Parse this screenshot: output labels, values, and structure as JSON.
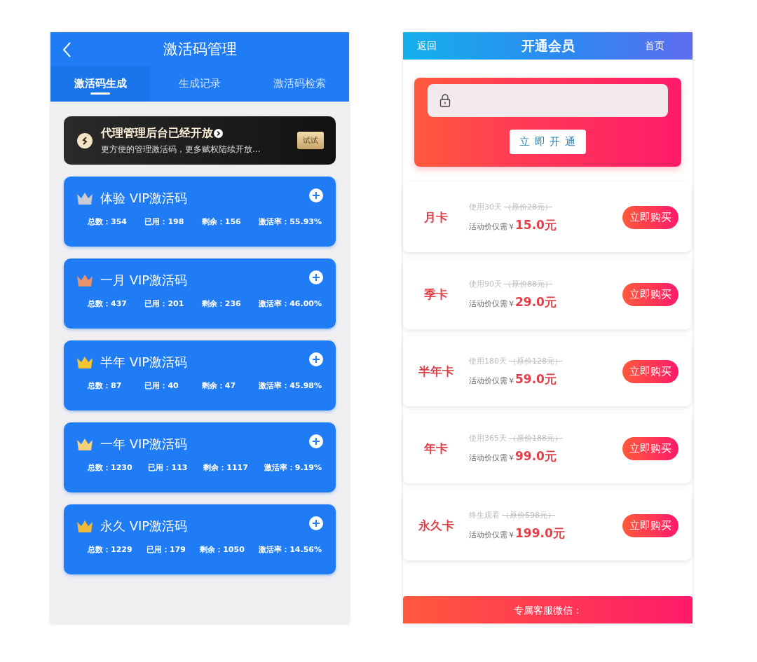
{
  "left": {
    "title": "激活码管理",
    "tabs": [
      {
        "label": "激活码生成",
        "selected": true
      },
      {
        "label": "生成记录",
        "selected": false
      },
      {
        "label": "激活码检索",
        "selected": false
      }
    ],
    "banner": {
      "title": "代理管理后台已经开放",
      "subtitle": "更方便的管理激活码，更多赋权陆续开放...",
      "button": "试试"
    },
    "cards": [
      {
        "title": "体验 VIP激活码",
        "color": "#c9ccd4",
        "stats": [
          "总数：354",
          "已用：198",
          "剩余：156",
          "激活率：55.93%"
        ]
      },
      {
        "title": "一月 VIP激活码",
        "color": "#e8936a",
        "stats": [
          "总数：437",
          "已用：201",
          "剩余：236",
          "激活率：46.00%"
        ]
      },
      {
        "title": "半年 VIP激活码",
        "color": "#f5c431",
        "stats": [
          "总数：87",
          "已用：40",
          "剩余：47",
          "激活率：45.98%"
        ]
      },
      {
        "title": "一年 VIP激活码",
        "color": "#f3d27a",
        "stats": [
          "总数：1230",
          "已用：113",
          "剩余：1117",
          "激活率：9.19%"
        ]
      },
      {
        "title": "永久 VIP激活码",
        "color": "#f0b93a",
        "stats": [
          "总数：1229",
          "已用：179",
          "剩余：1050",
          "激活率：14.56%"
        ]
      }
    ]
  },
  "right": {
    "back": "返回",
    "title": "开通会员",
    "home": "首页",
    "activate_button": "立 即 开 通",
    "plans": [
      {
        "name": "月卡",
        "duration": "使用30天",
        "original_price": "（原价28元）",
        "price_label": "活动价仅需￥",
        "price": "15.0元",
        "button": "立即购买"
      },
      {
        "name": "季卡",
        "duration": "使用90天",
        "original_price": "（原价88元）",
        "price_label": "活动价仅需￥",
        "price": "29.0元",
        "button": "立即购买"
      },
      {
        "name": "半年卡",
        "duration": "使用180天",
        "original_price": "（原价128元）",
        "price_label": "活动价仅需￥",
        "price": "59.0元",
        "button": "立即购买"
      },
      {
        "name": "年卡",
        "duration": "使用365天",
        "original_price": "（原价188元）",
        "price_label": "活动价仅需￥",
        "price": "99.0元",
        "button": "立即购买"
      },
      {
        "name": "永久卡",
        "duration": "终生观看",
        "original_price": "（原价598元）",
        "price_label": "活动价仅需￥",
        "price": "199.0元",
        "button": "立即购买"
      }
    ],
    "footer": "专属客服微信："
  }
}
